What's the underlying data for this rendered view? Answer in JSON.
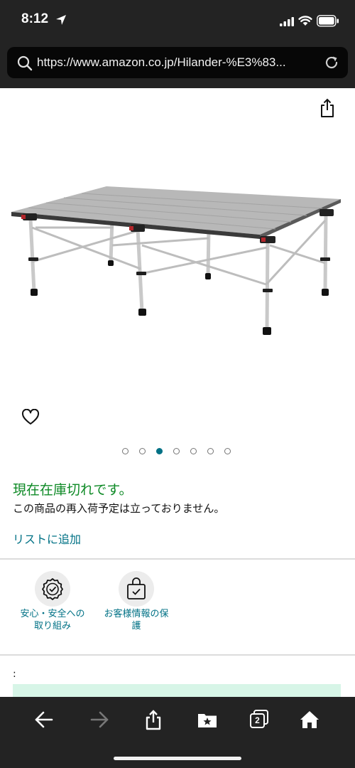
{
  "status_bar": {
    "time": "8:12"
  },
  "address_bar": {
    "url": "https://www.amazon.co.jp/Hilander-%E3%83..."
  },
  "carousel": {
    "dot_count": 7,
    "active_index": 2
  },
  "availability": {
    "status": "現在在庫切れです。",
    "note": "この商品の再入荷予定は立っておりません。"
  },
  "add_to_list": {
    "label": "リストに追加"
  },
  "badges": [
    {
      "label": "安心・安全への\n取り組み",
      "icon": "shield-check-icon"
    },
    {
      "label": "お客様情報の保\n護",
      "icon": "lock-bag-icon"
    }
  ],
  "misc": {
    "colon": ":"
  },
  "toolbar": {
    "tabs_count": "2",
    "icons": [
      "back-icon",
      "forward-icon",
      "share-icon",
      "bookmarks-icon",
      "tabs-icon",
      "home-icon"
    ]
  },
  "colors": {
    "chrome_bg": "#232323",
    "in_stock_status": "#0e8a26",
    "link": "#007185"
  }
}
